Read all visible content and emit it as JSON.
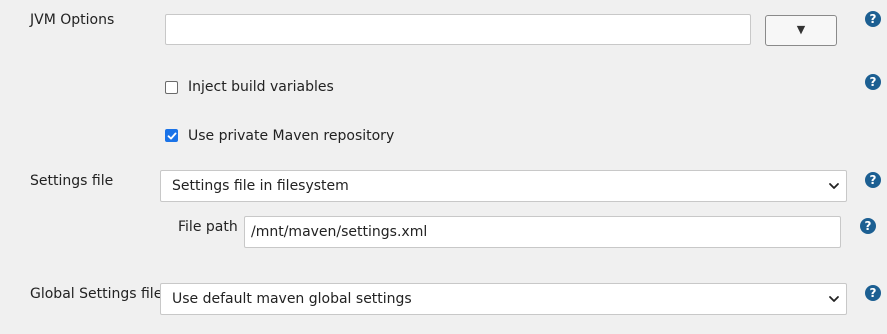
{
  "jvm": {
    "label": "JVM Options",
    "value": "",
    "expand_symbol": "▼"
  },
  "inject": {
    "label": "Inject build variables",
    "checked": false
  },
  "private_repo": {
    "label": "Use private Maven repository",
    "checked": true
  },
  "settings": {
    "label": "Settings file",
    "selected": "Settings file in filesystem",
    "file_path_label": "File path",
    "file_path_value": "/mnt/maven/settings.xml"
  },
  "global_settings": {
    "label": "Global Settings file",
    "selected": "Use default maven global settings"
  },
  "help_symbol": "?",
  "colors": {
    "help_bg": "#1c5f92",
    "checkbox_checked": "#1a73e8",
    "page_bg": "#f0f0f0"
  }
}
